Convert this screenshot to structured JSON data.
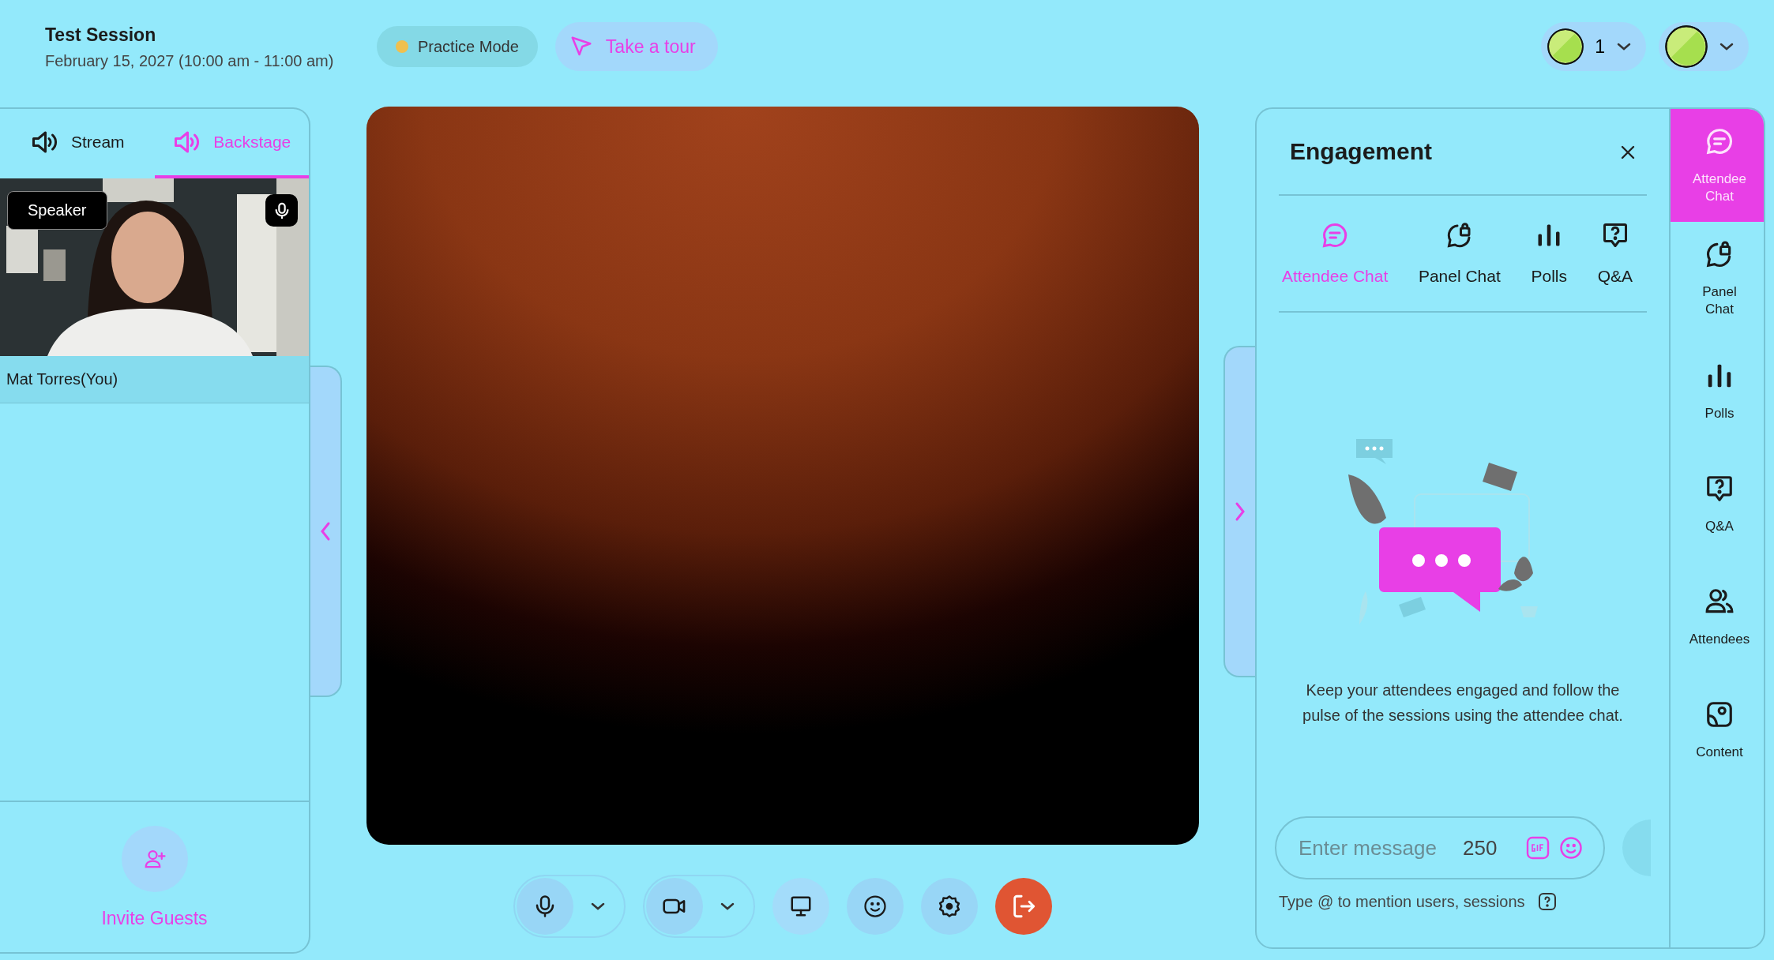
{
  "session": {
    "title": "Test Session",
    "date": "February 15, 2027 (10:00 am - 11:00 am)"
  },
  "practice_badge": {
    "label": "Practice Mode"
  },
  "tour_button": {
    "label": "Take a tour"
  },
  "participant_count": "1",
  "left_panel": {
    "tabs": [
      {
        "label": "Stream",
        "selected": false
      },
      {
        "label": "Backstage",
        "selected": true
      }
    ],
    "tile": {
      "kind": "picture",
      "badge": "Speaker",
      "name": "Mat Torres(You)"
    },
    "invite": {
      "label": "Invite Guests"
    }
  },
  "controls": [
    {
      "kind": "mic",
      "dropdown": true
    },
    {
      "kind": "camera",
      "dropdown": true
    },
    {
      "kind": "screen",
      "dropdown": false
    },
    {
      "kind": "reactions",
      "dropdown": false
    },
    {
      "kind": "settings",
      "dropdown": false
    },
    {
      "kind": "leave",
      "dropdown": false
    }
  ],
  "engagement": {
    "title": "Engagement",
    "tabs": [
      {
        "label": "Attendee Chat",
        "kind": "chat",
        "selected": true
      },
      {
        "label": "Panel Chat",
        "kind": "panel",
        "selected": false
      },
      {
        "label": "Polls",
        "kind": "polls",
        "selected": false
      },
      {
        "label": "Q&A",
        "kind": "qa",
        "selected": false
      }
    ],
    "empty_text": "Keep your attendees engaged and follow the pulse of the sessions using the attendee chat.",
    "message": {
      "placeholder": "Enter message",
      "counter": "250"
    },
    "hint": "Type @ to mention users, sessions"
  },
  "rail": [
    {
      "label": "Attendee Chat",
      "kind": "chat",
      "selected": true
    },
    {
      "label": "Panel Chat",
      "kind": "panel",
      "selected": false
    },
    {
      "label": "Polls",
      "kind": "polls",
      "selected": false
    },
    {
      "label": "Q&A",
      "kind": "qa",
      "selected": false
    },
    {
      "label": "Attendees",
      "kind": "people",
      "selected": false
    },
    {
      "label": "Content",
      "kind": "content",
      "selected": false
    }
  ]
}
